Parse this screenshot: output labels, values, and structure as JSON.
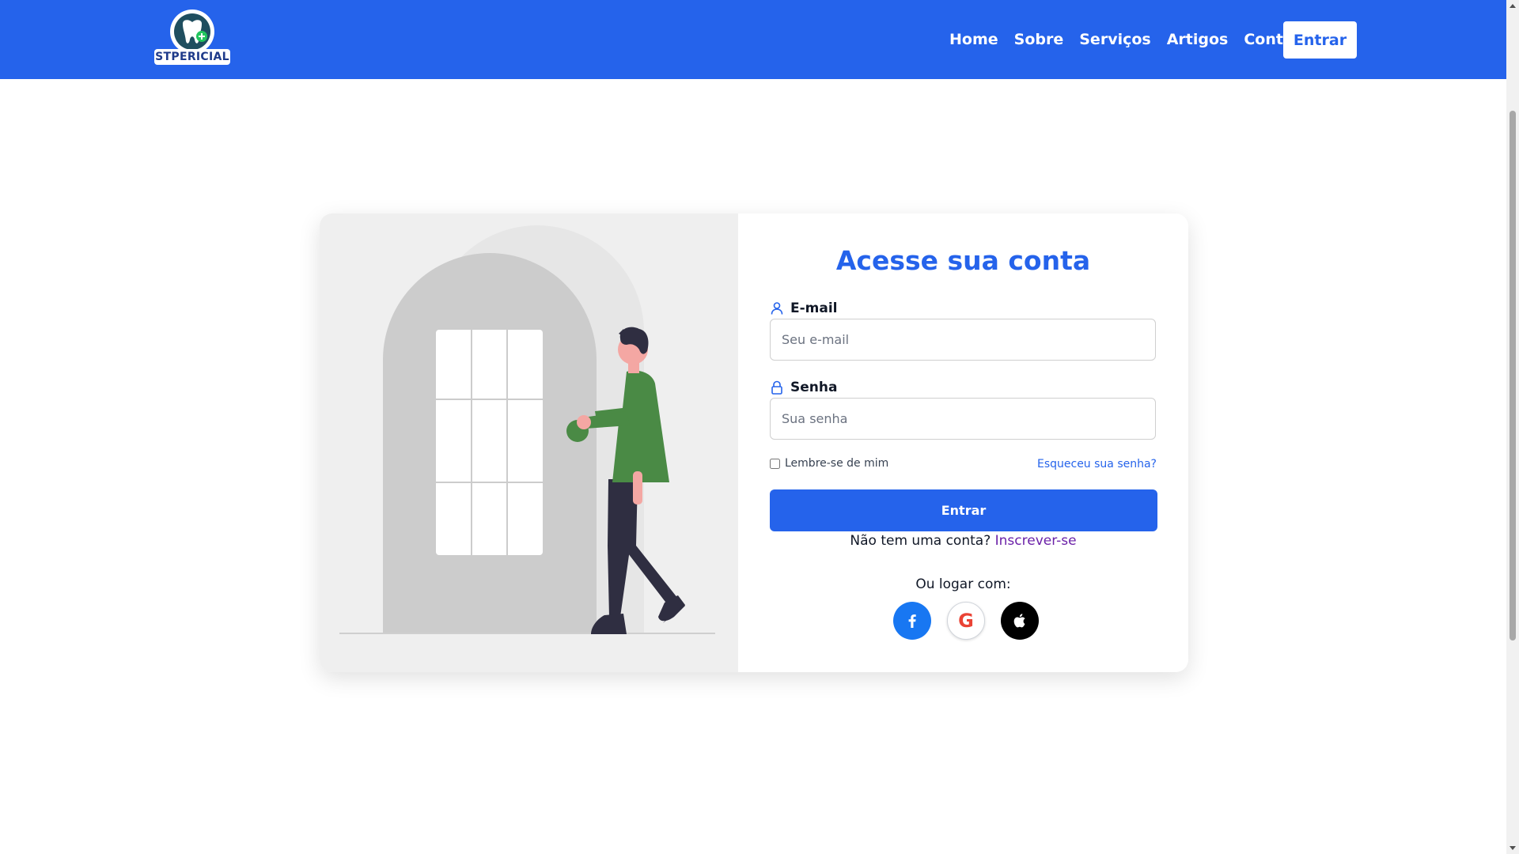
{
  "brand": {
    "name": "STPERICIAL"
  },
  "nav": {
    "links": [
      "Home",
      "Sobre",
      "Serviços",
      "Artigos",
      "Contato"
    ],
    "login_label": "Entrar"
  },
  "form": {
    "title": "Acesse sua conta",
    "email": {
      "label": "E-mail",
      "placeholder": "Seu e-mail",
      "value": ""
    },
    "password": {
      "label": "Senha",
      "placeholder": "Sua senha",
      "value": ""
    },
    "remember_label": "Lembre-se de mim",
    "remember_checked": false,
    "forgot_label": "Esqueceu sua senha?",
    "submit_label": "Entrar",
    "signup_prompt": "Não tem uma conta?",
    "signup_link": "Inscrever-se",
    "social_prompt": "Ou logar com:",
    "social": [
      "facebook-icon",
      "google-icon",
      "apple-icon"
    ]
  },
  "colors": {
    "primary": "#2563eb",
    "signup_link": "#6b21a8",
    "shirt": "#4a8a45",
    "pants": "#2f2e41",
    "skin": "#f4a7a3",
    "door": "#cccccc",
    "facebook": "#1877f2",
    "google_red": "#ea4335"
  }
}
